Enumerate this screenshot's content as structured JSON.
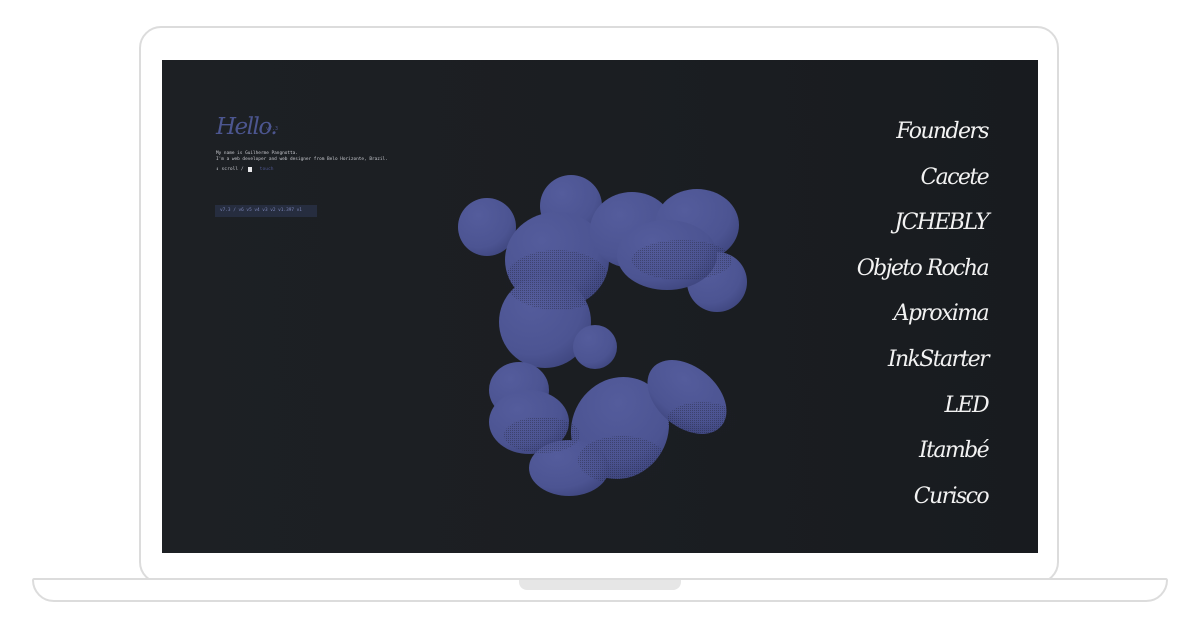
{
  "intro": {
    "title": "Hello.",
    "version_tag": "v7.3",
    "bio_lines": [
      "My name is Guilherme Pangnotta.",
      "I'm a web developer and web designer from Belo Horizonte, Brazil."
    ],
    "scroll_hint": "↕ scroll /",
    "touch_hint": "touch",
    "versions": "v7.3 / v6 v5 v4 v3 v2 v1.397 v1"
  },
  "projects": [
    "Founders",
    "Cacete",
    "JCHEBLY",
    "Objeto Rocha",
    "Aproxima",
    "InkStarter",
    "LED",
    "Itambé",
    "Curisco"
  ],
  "colors": {
    "accent": "#4c5690",
    "blob": "#4d5593",
    "screen_bg": "#1b1e22",
    "text": "#f2f2f2"
  }
}
